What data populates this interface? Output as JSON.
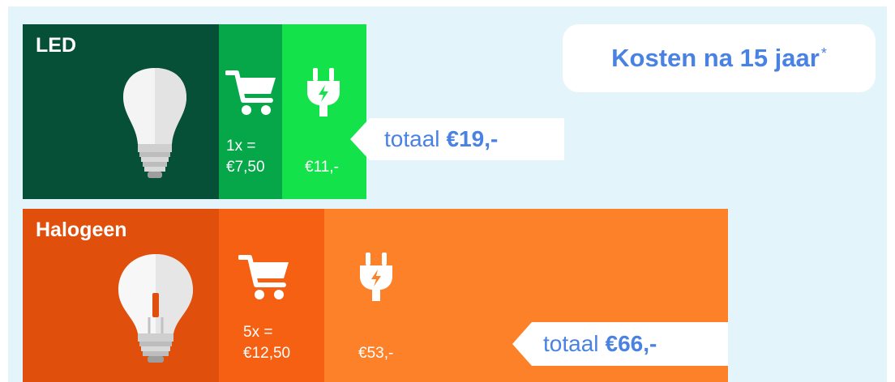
{
  "headline": {
    "title": "Kosten na 15 jaar",
    "footnote_mark": "*"
  },
  "led": {
    "label": "LED",
    "purchase_line1": "1x =",
    "purchase_line2": "€7,50",
    "energy_cost": "€11,-",
    "total_prefix": "totaal",
    "total_value": "€19,-"
  },
  "halogeen": {
    "label": "Halogeen",
    "purchase_line1": "5x =",
    "purchase_line2": "€12,50",
    "energy_cost": "€53,-",
    "total_prefix": "totaal",
    "total_value": "€66,-"
  },
  "colors": {
    "led_dark": "#055036",
    "led_mid": "#06a748",
    "led_bright": "#14e24a",
    "halogen_dark": "#e14f0c",
    "halogen_mid": "#f56012",
    "halogen_light": "#fd8128",
    "accent_blue": "#4a82e4",
    "background": "#e4f4fb"
  },
  "icons": [
    "led-bulb-icon",
    "shopping-cart-icon",
    "electric-plug-icon",
    "halogen-bulb-icon"
  ]
}
